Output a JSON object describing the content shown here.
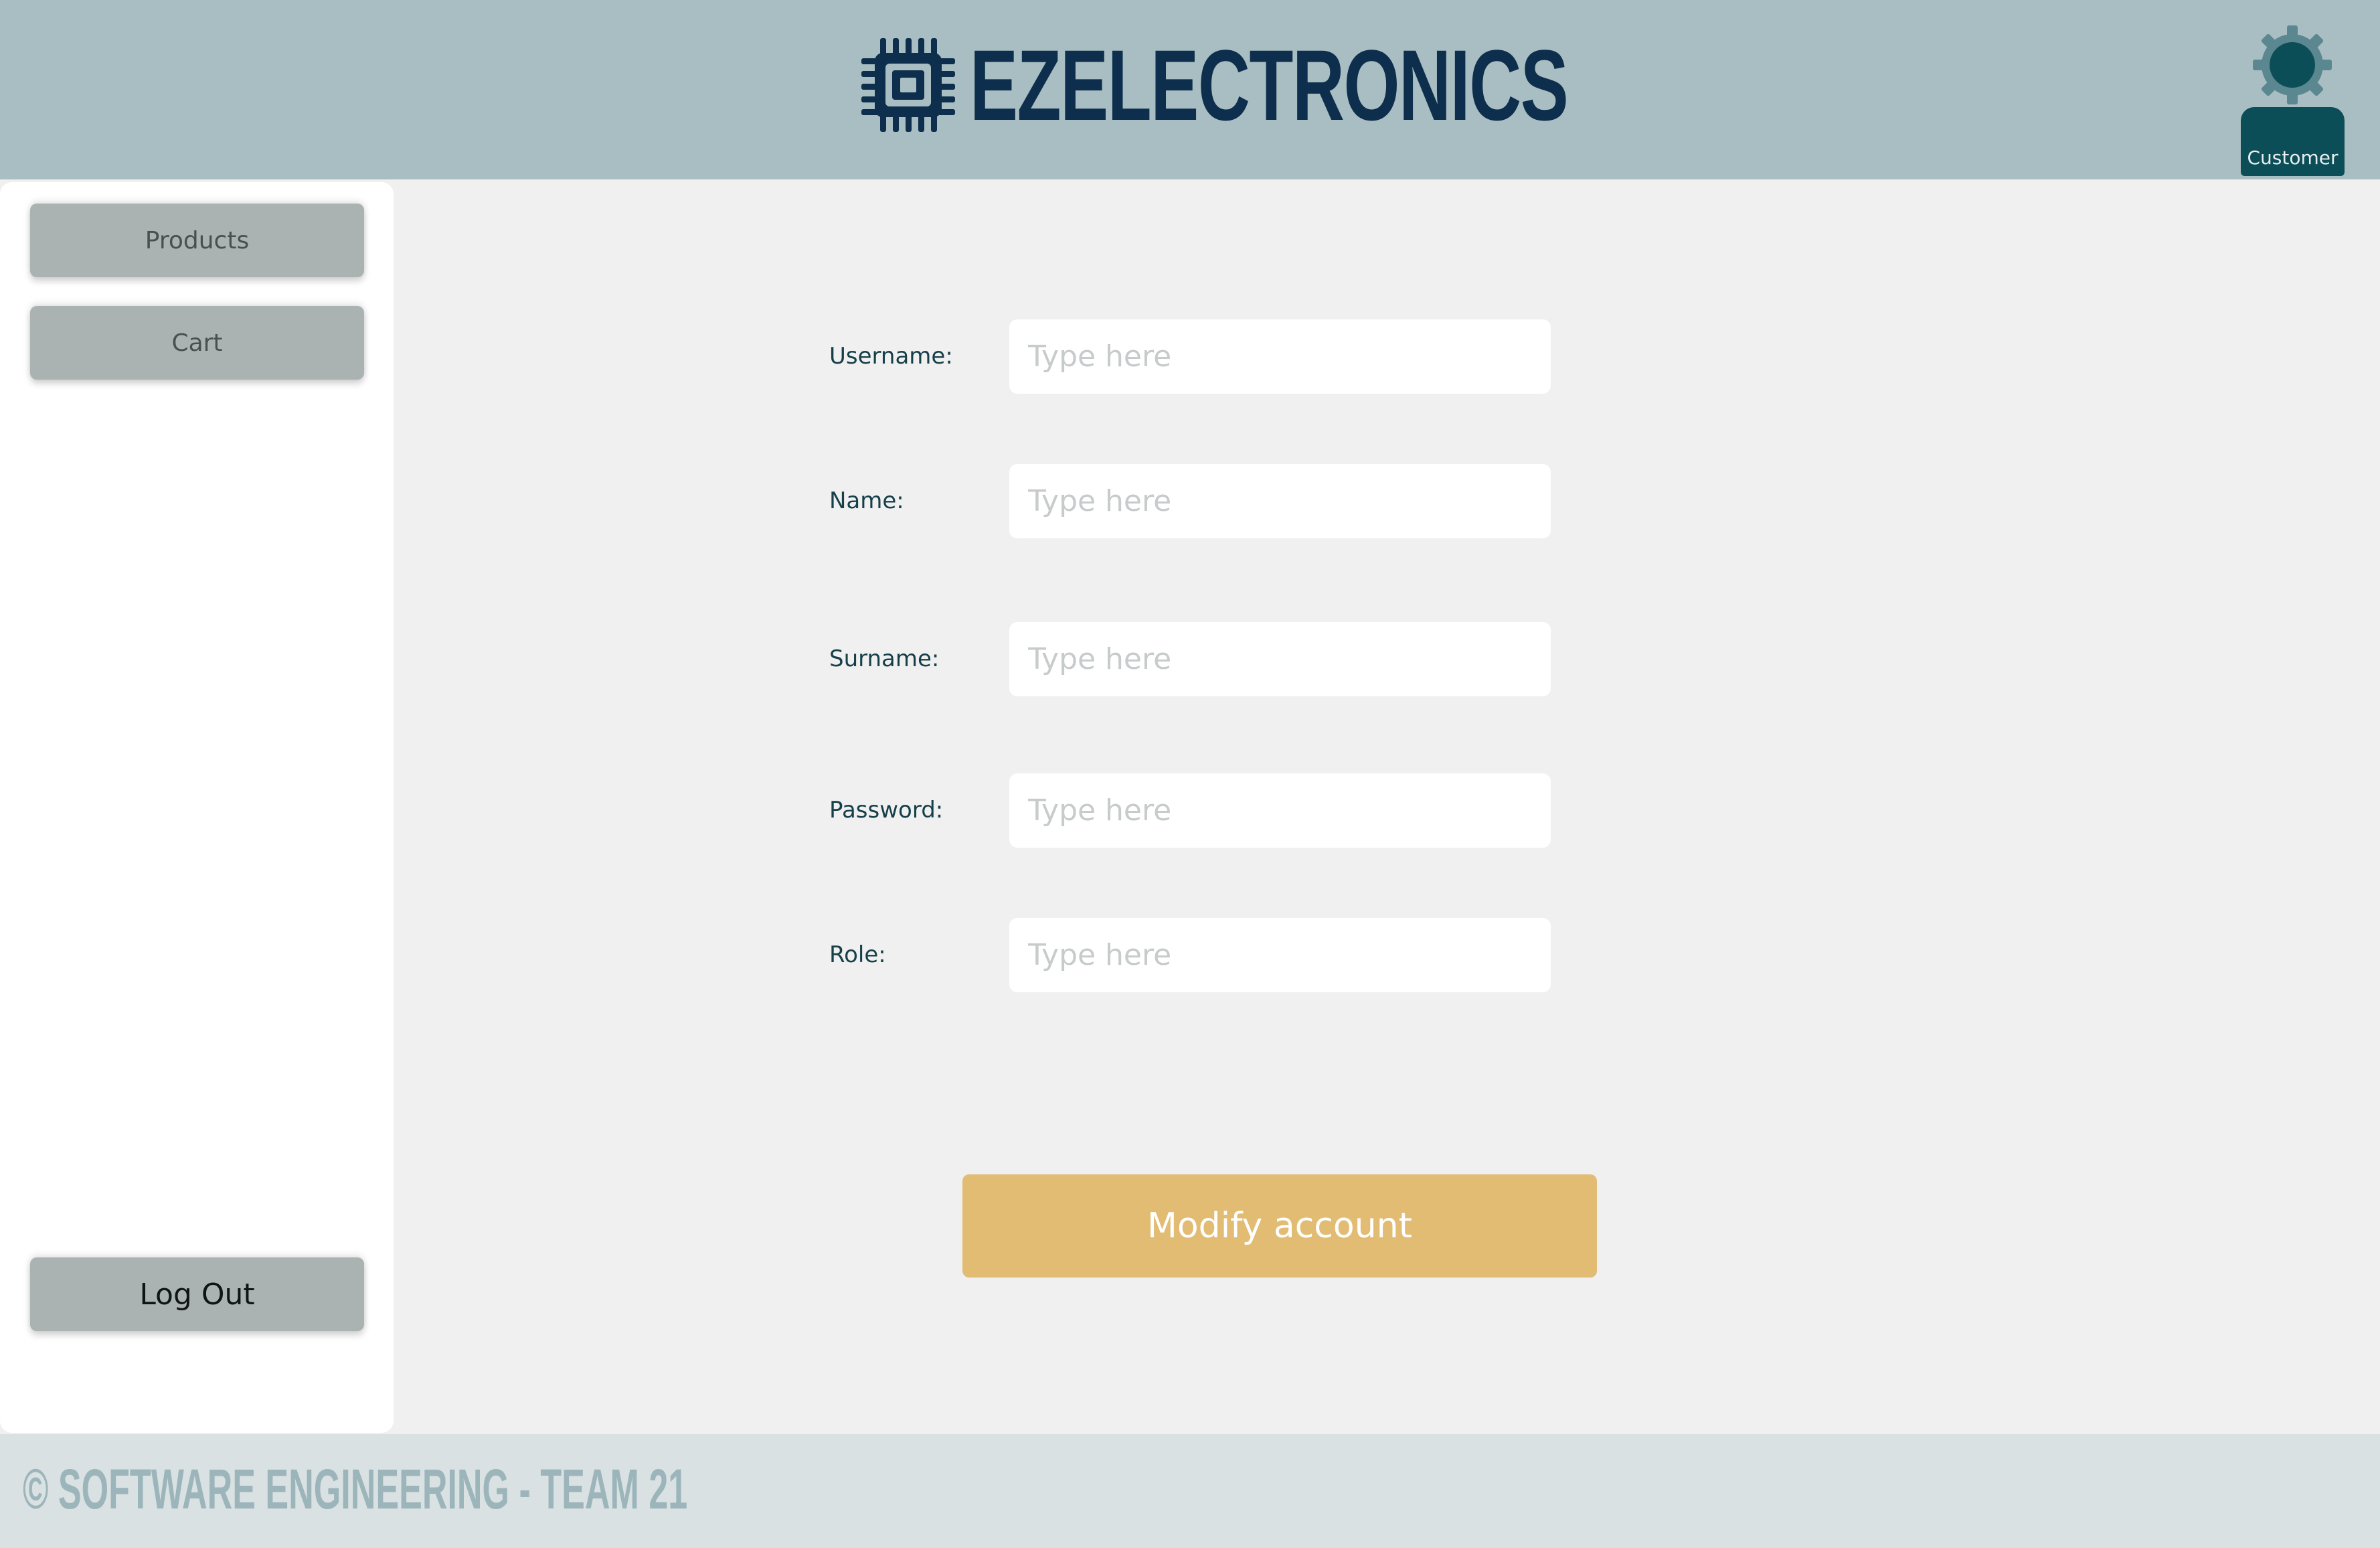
{
  "header": {
    "brand": "EZELECTRONICS",
    "user_role": "Customer"
  },
  "sidebar": {
    "items": [
      {
        "label": "Products"
      },
      {
        "label": "Cart"
      }
    ],
    "logout_label": "Log Out"
  },
  "form": {
    "fields": [
      {
        "label": "Username:",
        "placeholder": "Type here",
        "value": ""
      },
      {
        "label": "Name:",
        "placeholder": "Type here",
        "value": ""
      },
      {
        "label": "Surname:",
        "placeholder": "Type here",
        "value": ""
      },
      {
        "label": "Password:",
        "placeholder": "Type here",
        "value": ""
      },
      {
        "label": "Role:",
        "placeholder": "Type here",
        "value": ""
      }
    ],
    "submit_label": "Modify account"
  },
  "footer": {
    "text": "© SOFTWARE ENGINEERING - TEAM 21"
  },
  "colors": {
    "header_bg": "#a9bec2",
    "brand_text": "#0d2e4c",
    "accent_button": "#e1bc72",
    "user_badge": "#0c4e57",
    "sidebar_button": "#abb3b2",
    "footer_bg": "#d9e1e2"
  },
  "icons": {
    "logo": "chip-icon",
    "user": "user-avatar-icon"
  }
}
